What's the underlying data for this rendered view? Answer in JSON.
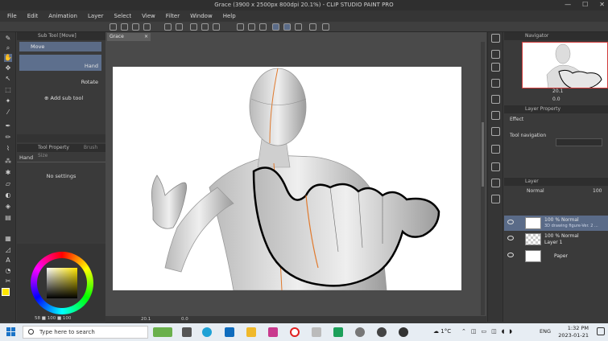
{
  "window": {
    "title": "Grace (3900 x 2500px 800dpi 20.1%) - CLIP STUDIO PAINT PRO",
    "min": "—",
    "max": "☐",
    "close": "✕"
  },
  "menu": [
    "File",
    "Edit",
    "Animation",
    "Layer",
    "Select",
    "View",
    "Filter",
    "Window",
    "Help"
  ],
  "subtool_panel": {
    "header": "Sub Tool [Move]",
    "active_tab": "Move",
    "items": [
      {
        "label": "Hand",
        "selected": true
      },
      {
        "label": "Rotate",
        "selected": false
      }
    ],
    "add_label": "Add sub tool"
  },
  "tool_property": {
    "header": "Tool Property",
    "header2": "Brush Size",
    "tool_name": "Hand",
    "empty_text": "No settings"
  },
  "color": {
    "main": "#ffe600",
    "sub": "#ffffff",
    "values": "58 ■ 100 ■ 100"
  },
  "document": {
    "tab_label": "Grace",
    "tab_close": "×",
    "zoom": "20.1",
    "rotation": "0.0"
  },
  "navigator": {
    "header": "Navigator",
    "zoom": "20.1",
    "rotation": "0.0"
  },
  "layer_property": {
    "header": "Layer Property",
    "effect_label": "Effect",
    "tool_navigation_label": "Tool navigation"
  },
  "layer_panel": {
    "header": "Layer",
    "blend_mode": "Normal",
    "opacity": "100",
    "layers": [
      {
        "line1": "100 % Normal",
        "line2": "3D drawing figure-Ver. 2 ...",
        "selected": true
      },
      {
        "line1": "100 % Normal",
        "line2": "Layer 1",
        "selected": false
      },
      {
        "line1": "",
        "line2": "Paper",
        "selected": false
      }
    ]
  },
  "taskbar": {
    "search_placeholder": "Type here to search",
    "temperature": "1°C",
    "language": "ENG",
    "time": "1:32 PM",
    "date": "2023-01-21"
  }
}
